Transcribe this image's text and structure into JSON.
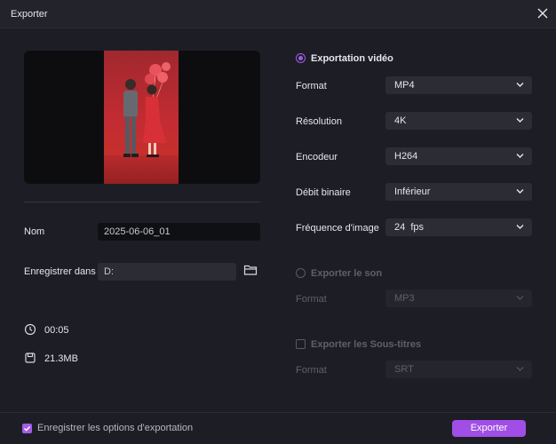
{
  "window": {
    "title": "Exporter"
  },
  "left": {
    "name_label": "Nom",
    "name_value": "2025-06-06_01",
    "save_label": "Enregistrer dans",
    "save_value": "D:",
    "duration": "00:05",
    "size": "21.3MB"
  },
  "video": {
    "title": "Exportation vidéo",
    "rows": [
      {
        "label": "Format",
        "value": "MP4"
      },
      {
        "label": "Résolution",
        "value": "4K"
      },
      {
        "label": "Encodeur",
        "value": "H264"
      },
      {
        "label": "Débit binaire",
        "value": "Inférieur"
      },
      {
        "label": "Fréquence d'image",
        "value": "24  fps"
      }
    ]
  },
  "audio": {
    "title": "Exporter le son",
    "format_label": "Format",
    "format_value": "MP3"
  },
  "subtitles": {
    "title": "Exporter les Sous-titres",
    "format_label": "Format",
    "format_value": "SRT"
  },
  "footer": {
    "remember_label": "Enregistrer les options d'exportation",
    "export_label": "Exporter"
  },
  "colors": {
    "accent": "#a04ee6",
    "background": "#1d1e25",
    "field": "#2b2c34"
  }
}
